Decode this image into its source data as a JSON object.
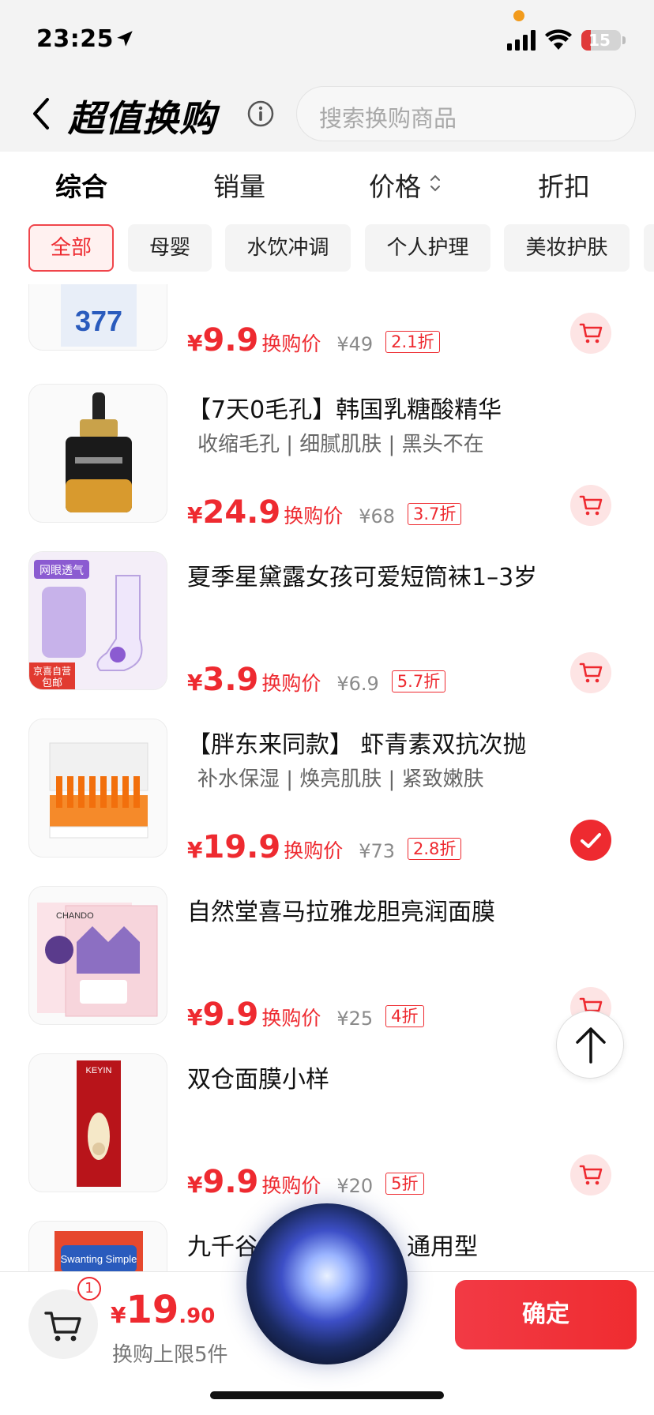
{
  "status_bar": {
    "time": "23:25",
    "battery": "15"
  },
  "header": {
    "title": "超值换购",
    "search_placeholder": "搜索换购商品"
  },
  "sort_tabs": [
    {
      "label": "综合",
      "active": true
    },
    {
      "label": "销量",
      "active": false
    },
    {
      "label": "价格",
      "active": false
    },
    {
      "label": "折扣",
      "active": false
    }
  ],
  "categories": [
    {
      "label": "全部",
      "active": true
    },
    {
      "label": "母婴",
      "active": false
    },
    {
      "label": "水饮冲调",
      "active": false
    },
    {
      "label": "个人护理",
      "active": false
    },
    {
      "label": "美妆护肤",
      "active": false
    }
  ],
  "products": [
    {
      "title": "",
      "subtitle": "",
      "price_currency": "¥",
      "price": "9.9",
      "price_label": "换购价",
      "original_price": "¥49",
      "discount": "2.1折",
      "selected": false,
      "thumb_icon": "mask-box-377"
    },
    {
      "title": "【7天0毛孔】韩国乳糖酸精华",
      "subtitle": "收缩毛孔 | 细腻肌肤 | 黑头不在",
      "price_currency": "¥",
      "price": "24.9",
      "price_label": "换购价",
      "original_price": "¥68",
      "discount": "3.7折",
      "selected": false,
      "thumb_icon": "serum-bottle"
    },
    {
      "title": "夏季星黛露女孩可爱短筒袜1–3岁",
      "subtitle": "",
      "price_currency": "¥",
      "price": "3.9",
      "price_label": "换购价",
      "original_price": "¥6.9",
      "discount": "5.7折",
      "selected": false,
      "thumb_icon": "kids-socks",
      "thumb_tags": [
        "网眼透气",
        "京喜自营",
        "包邮"
      ]
    },
    {
      "title": "【胖东来同款】 虾青素双抗次抛",
      "subtitle": "补水保湿 | 焕亮肌肤 | 紧致嫩肤",
      "price_currency": "¥",
      "price": "19.9",
      "price_label": "换购价",
      "original_price": "¥73",
      "discount": "2.8折",
      "selected": true,
      "thumb_icon": "ampoule-box"
    },
    {
      "title": "自然堂喜马拉雅龙胆亮润面膜",
      "subtitle": "",
      "price_currency": "¥",
      "price": "9.9",
      "price_label": "换购价",
      "original_price": "¥25",
      "discount": "4折",
      "selected": false,
      "thumb_icon": "face-mask-pack",
      "thumb_tags": [
        "CHANDO"
      ]
    },
    {
      "title": "双仓面膜小样",
      "subtitle": "",
      "price_currency": "¥",
      "price": "9.9",
      "price_label": "换购价",
      "original_price": "¥20",
      "discount": "5折",
      "selected": false,
      "thumb_icon": "mask-sample",
      "thumb_tags": [
        "KEYIN"
      ]
    },
    {
      "title": "九千谷",
      "title_tail": "通用型",
      "subtitle": "",
      "price_currency": "¥",
      "price": "",
      "price_label": "",
      "original_price": "",
      "discount": "",
      "selected": false,
      "thumb_icon": "product-box",
      "thumb_tags": [
        "Swanting Simple"
      ]
    }
  ],
  "footer": {
    "cart_count": "1",
    "price_currency": "¥",
    "price_int": "19",
    "price_dec": ".90",
    "limit_text": "换购上限5件",
    "confirm_label": "确定"
  },
  "colors": {
    "accent": "#ee2a30",
    "chip_active_bg": "#fff1f0",
    "cart_btn_bg": "#fde4e4"
  }
}
